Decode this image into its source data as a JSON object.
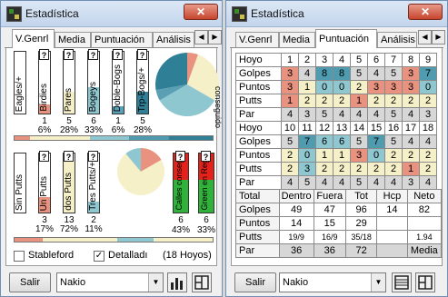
{
  "left": {
    "title": "Estadística",
    "close": "✕",
    "tabs": [
      "V.Genrl",
      "Media",
      "Puntuación",
      "Análisis"
    ],
    "bars_top": [
      {
        "label": "Eagles/+",
        "count": "",
        "pct": "",
        "level": 0,
        "color": "#e8927f"
      },
      {
        "label": "Birdies",
        "count": "1",
        "pct": "6%",
        "level": 0.14,
        "color": "#e8927f"
      },
      {
        "label": "Pares",
        "count": "5",
        "pct": "28%",
        "level": 0.36,
        "color": "#f6f0c8"
      },
      {
        "label": "Bogeys",
        "count": "6",
        "pct": "33%",
        "level": 0.42,
        "color": "#8fc7d1"
      },
      {
        "label": "Doble-Bogs",
        "count": "1",
        "pct": "6%",
        "level": 0.12,
        "color": "#5a9fb3"
      },
      {
        "label": "Trp-Bogs/+",
        "count": "5",
        "pct": "28%",
        "level": 0.36,
        "color": "#2f7f96"
      }
    ],
    "pie_top_label": "conseguido",
    "bars_bottom": [
      {
        "label": "Sin Putts",
        "count": "",
        "pct": "",
        "level": 0,
        "color": "#e8927f"
      },
      {
        "label": "Un Putts",
        "count": "3",
        "pct": "17%",
        "level": 0.26,
        "color": "#e8927f"
      },
      {
        "label": "dos Putts",
        "count": "13",
        "pct": "72%",
        "level": 0.86,
        "color": "#f6f0c8"
      },
      {
        "label": "Tres Putts/+",
        "count": "2",
        "pct": "11%",
        "level": 0.18,
        "color": "#8fc7d1"
      }
    ],
    "calles": {
      "label": "Calles conseguid",
      "count": "6",
      "pct": "43%"
    },
    "greens": {
      "label": "Green en Reg",
      "count": "6",
      "pct": "33%"
    },
    "stableford_label": "Stableford",
    "detallado_label": "Detalladı",
    "hoyos": "(18 Hoyos)",
    "salir": "Salir",
    "player": "Nakio"
  },
  "right": {
    "title": "Estadística",
    "close": "✕",
    "tabs": [
      "V.Genrl",
      "Media",
      "Puntuación",
      "Análisis"
    ],
    "front": {
      "hoyo": [
        "Hoyo",
        "1",
        "2",
        "3",
        "4",
        "5",
        "6",
        "7",
        "8",
        "9"
      ],
      "golpes": [
        "Golpes",
        "3",
        "4",
        "8",
        "8",
        "5",
        "4",
        "5",
        "3",
        "7"
      ],
      "puntos": [
        "Puntos",
        "3",
        "1",
        "0",
        "0",
        "2",
        "3",
        "3",
        "3",
        "0"
      ],
      "putts": [
        "Putts",
        "1",
        "2",
        "2",
        "2",
        "1",
        "2",
        "2",
        "2",
        "2"
      ],
      "par": [
        "Par",
        "4",
        "3",
        "5",
        "4",
        "4",
        "4",
        "5",
        "4",
        "3"
      ]
    },
    "back": {
      "hoyo": [
        "Hoyo",
        "10",
        "11",
        "12",
        "13",
        "14",
        "15",
        "16",
        "17",
        "18"
      ],
      "golpes": [
        "Golpes",
        "5",
        "7",
        "6",
        "6",
        "5",
        "7",
        "5",
        "4",
        "4"
      ],
      "puntos": [
        "Puntos",
        "2",
        "0",
        "1",
        "1",
        "3",
        "0",
        "2",
        "2",
        "2"
      ],
      "putts": [
        "Putts",
        "2",
        "3",
        "2",
        "2",
        "2",
        "2",
        "2",
        "1",
        "2"
      ],
      "par": [
        "Par",
        "4",
        "5",
        "4",
        "4",
        "5",
        "4",
        "4",
        "3",
        "4"
      ]
    },
    "totals": {
      "head": [
        "Total",
        "Dentro",
        "Fuera",
        "Tot",
        "Hcp",
        "Neto"
      ],
      "golpes": [
        "Golpes",
        "49",
        "47",
        "96",
        "14",
        "82"
      ],
      "puntos": [
        "Puntos",
        "14",
        "15",
        "29",
        "",
        ""
      ],
      "putts": [
        "Putts",
        "19/9",
        "16/9",
        "35/18",
        "",
        "1.94"
      ],
      "par": [
        "Par",
        "36",
        "36",
        "72",
        "",
        "Media"
      ]
    },
    "salir": "Salir",
    "player": "Nakio"
  }
}
